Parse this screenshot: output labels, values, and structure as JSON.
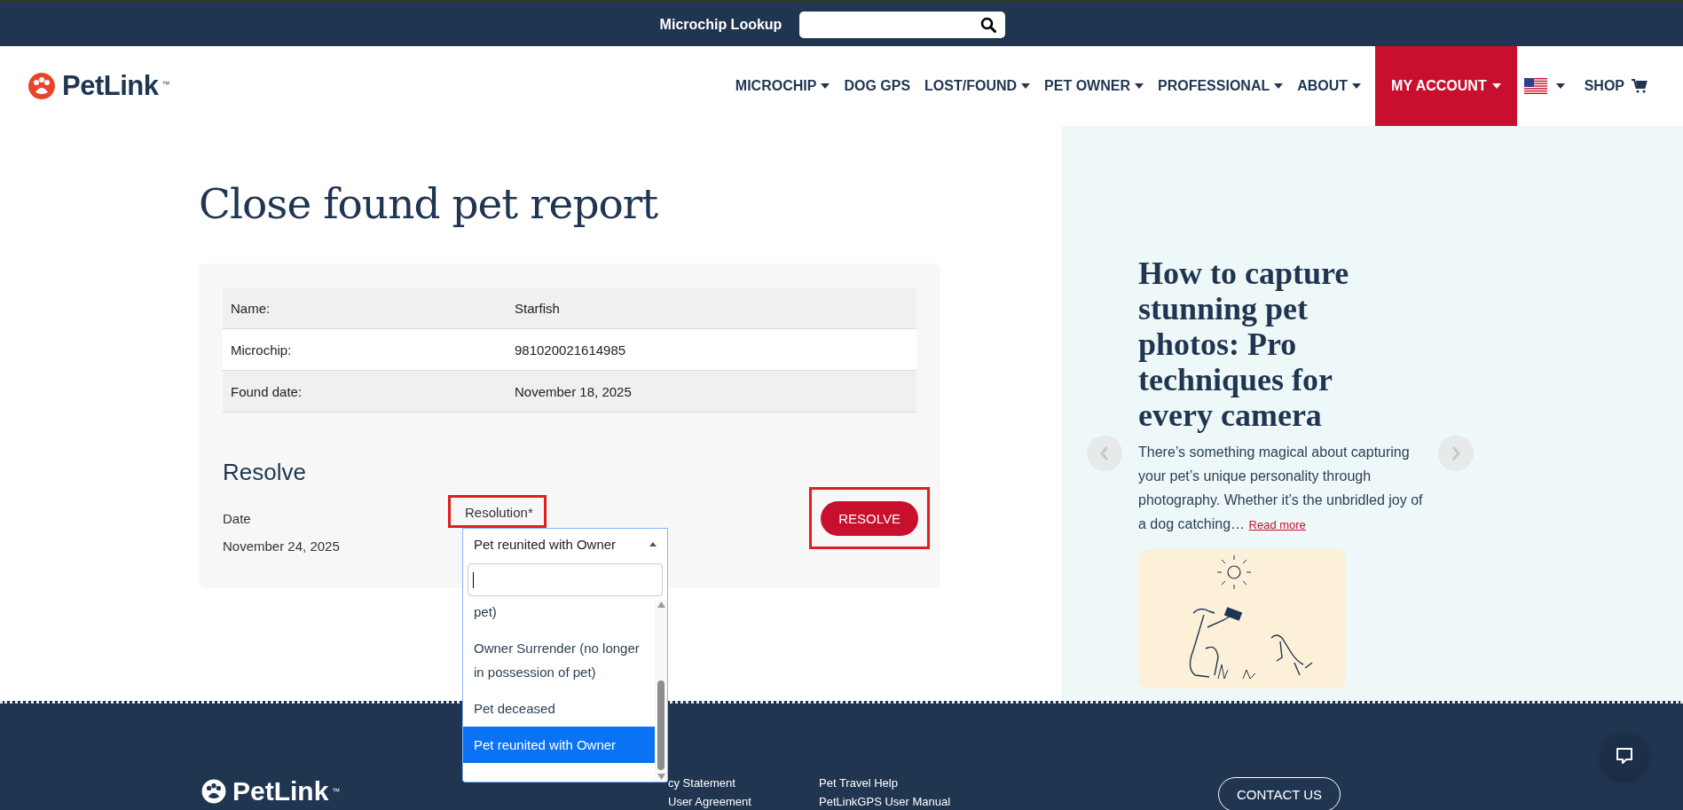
{
  "top_bar": {
    "label": "Microchip Lookup"
  },
  "nav": {
    "logo": "PetLink",
    "logo_mark": "™",
    "items": [
      {
        "label": "MICROCHIP",
        "has_menu": true
      },
      {
        "label": "DOG GPS",
        "has_menu": false
      },
      {
        "label": "LOST/FOUND",
        "has_menu": true
      },
      {
        "label": "PET OWNER",
        "has_menu": true
      },
      {
        "label": "PROFESSIONAL",
        "has_menu": true
      },
      {
        "label": "ABOUT",
        "has_menu": true
      }
    ],
    "account": {
      "label": "MY ACCOUNT",
      "selected": true
    },
    "shop": "SHOP"
  },
  "page": {
    "title": "Close found pet report",
    "details": [
      {
        "label": "Name:",
        "value": "Starfish"
      },
      {
        "label": "Microchip:",
        "value": "981020021614985"
      },
      {
        "label": "Found date:",
        "value": "November 18, 2025"
      }
    ],
    "resolve": {
      "heading": "Resolve",
      "date_label": "Date",
      "date_value": "November 24, 2025",
      "resolution_label": "Resolution*",
      "resolution_highlighted": true,
      "resolution_value": "Pet reunited with Owner",
      "options": [
        {
          "label": "pet)",
          "selected": false
        },
        {
          "label": "Owner Surrender (no longer in possession of pet)",
          "selected": false
        },
        {
          "label": "Pet deceased",
          "selected": false
        },
        {
          "label": "Pet reunited with Owner",
          "selected": true
        }
      ],
      "button": "RESOLVE",
      "button_highlighted": true
    }
  },
  "sidebar": {
    "title": "How to capture stunning pet photos: Pro techniques for every camera",
    "excerpt": "There’s something magical about capturing your pet’s unique personality through photography. Whether it’s the unbridled joy of a dog catching…",
    "link": "Read more"
  },
  "footer": {
    "logo": "PetLink",
    "logo_mark": "™",
    "columns": [
      [
        "cy Statement",
        "User Agreement"
      ],
      [
        "Pet Travel Help",
        "PetLinkGPS User Manual"
      ]
    ],
    "contact": "CONTACT US"
  }
}
